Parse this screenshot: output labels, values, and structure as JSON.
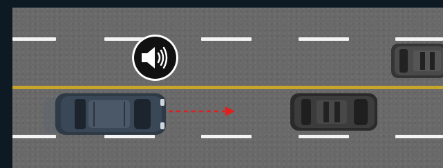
{
  "scene": {
    "colors": {
      "frame": "#0d1a24",
      "asphalt": "#696969",
      "lane_marking": "#f4f4f4",
      "center_line": "#c6a52a",
      "direction_arrow": "#e02020",
      "sound_badge": "#111111"
    },
    "icons": {
      "sound": "speaker-volume-icon",
      "direction": "dashed-arrow-right-icon"
    },
    "vehicles": [
      {
        "role": "ego-suv",
        "color": "#3a4757"
      },
      {
        "role": "lead-vehicle",
        "color": "#3c3c3c"
      },
      {
        "role": "oncoming-vehicle",
        "color": "#4a4a4a"
      }
    ]
  }
}
